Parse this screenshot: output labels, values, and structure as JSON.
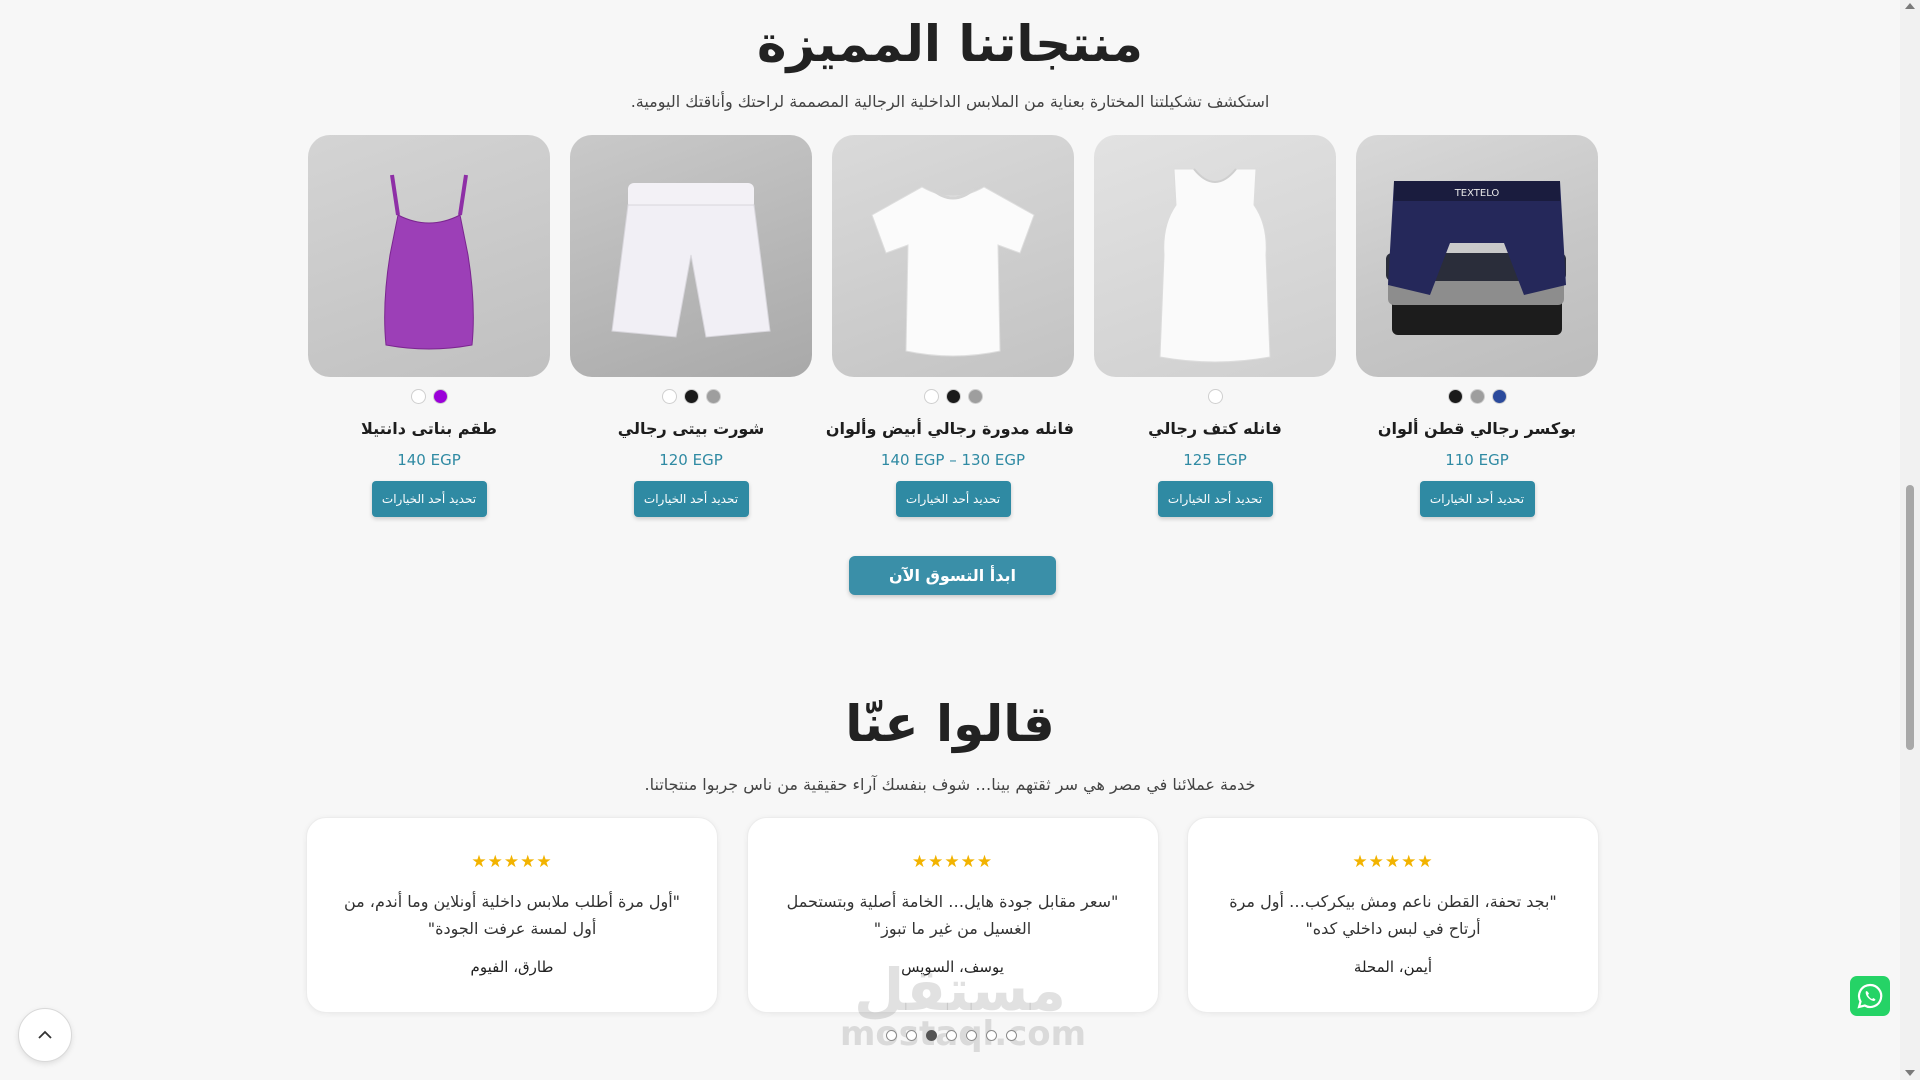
{
  "featured": {
    "title": "منتجاتنا المميزة",
    "subtitle": "استكشف تشكيلتنا المختارة بعناية من الملابس الداخلية الرجالية المصممة لراحتك وأناقتك اليومية.",
    "products": [
      {
        "name": "بوكسر رجالي قطن ألوان",
        "price": "110 EGP",
        "button": "تحديد أحد الخيارات",
        "image_icon": "boxer-briefs-image",
        "image_brand_text": "TEXTELO",
        "swatches": [
          "#1a1a1a",
          "#9e9e9e",
          "#2b4a9c"
        ]
      },
      {
        "name": "فانله كتف رجالي",
        "price": "125 EGP",
        "button": "تحديد أحد الخيارات",
        "image_icon": "tank-top-image",
        "swatches": [
          "#ffffff"
        ]
      },
      {
        "name": "فانله مدورة رجالي أبيض وألوان",
        "price": "140 EGP – 130 EGP",
        "button": "تحديد أحد الخيارات",
        "image_icon": "tshirt-image",
        "swatches": [
          "#ffffff",
          "#1a1a1a",
          "#9e9e9e"
        ]
      },
      {
        "name": "شورت بيتى رجالي",
        "price": "120 EGP",
        "button": "تحديد أحد الخيارات",
        "image_icon": "shorts-image",
        "swatches": [
          "#ffffff",
          "#1a1a1a",
          "#9e9e9e"
        ]
      },
      {
        "name": "طقم بناتى دانتيلا",
        "price": "140 EGP",
        "button": "تحديد أحد الخيارات",
        "image_icon": "camisole-image",
        "swatches": [
          "#ffffff",
          "#9b00d9"
        ]
      }
    ],
    "shop_button": "ابدأ التسوق الآن"
  },
  "testimonials": {
    "title": "قالوا عنّا",
    "subtitle": "خدمة عملائنا في مصر هي سر ثقتهم بينا… شوف بنفسك آراء حقيقية من ناس جربوا منتجاتنا.",
    "reviews": [
      {
        "stars": "★★★★★",
        "text": "\"بجد تحفة، القطن ناعم ومش بيكركب… أول مرة أرتاح في لبس داخلي كده\"",
        "author": "أيمن، المحلة"
      },
      {
        "stars": "★★★★★",
        "text": "\"سعر مقابل جودة هايل… الخامة أصلية وبتستحمل الغسيل من غير ما تبوز\"",
        "author": "يوسف، السويس"
      },
      {
        "stars": "★★★★★",
        "text": "\"أول مرة أطلب ملابس داخلية أونلاين وما أندم، من أول لمسة عرفت الجودة\"",
        "author": "طارق، الفيوم"
      }
    ],
    "pagination": {
      "total": 7,
      "active_index": 2
    }
  },
  "watermark": {
    "arabic": "مستقل",
    "latin": "mostaql.com"
  },
  "colors": {
    "accent": "#2f8aa3",
    "star": "#f2b300",
    "whatsapp": "#25d366"
  },
  "widgets": {
    "back_to_top_icon": "chevron-up-icon",
    "whatsapp_icon": "whatsapp-icon"
  }
}
